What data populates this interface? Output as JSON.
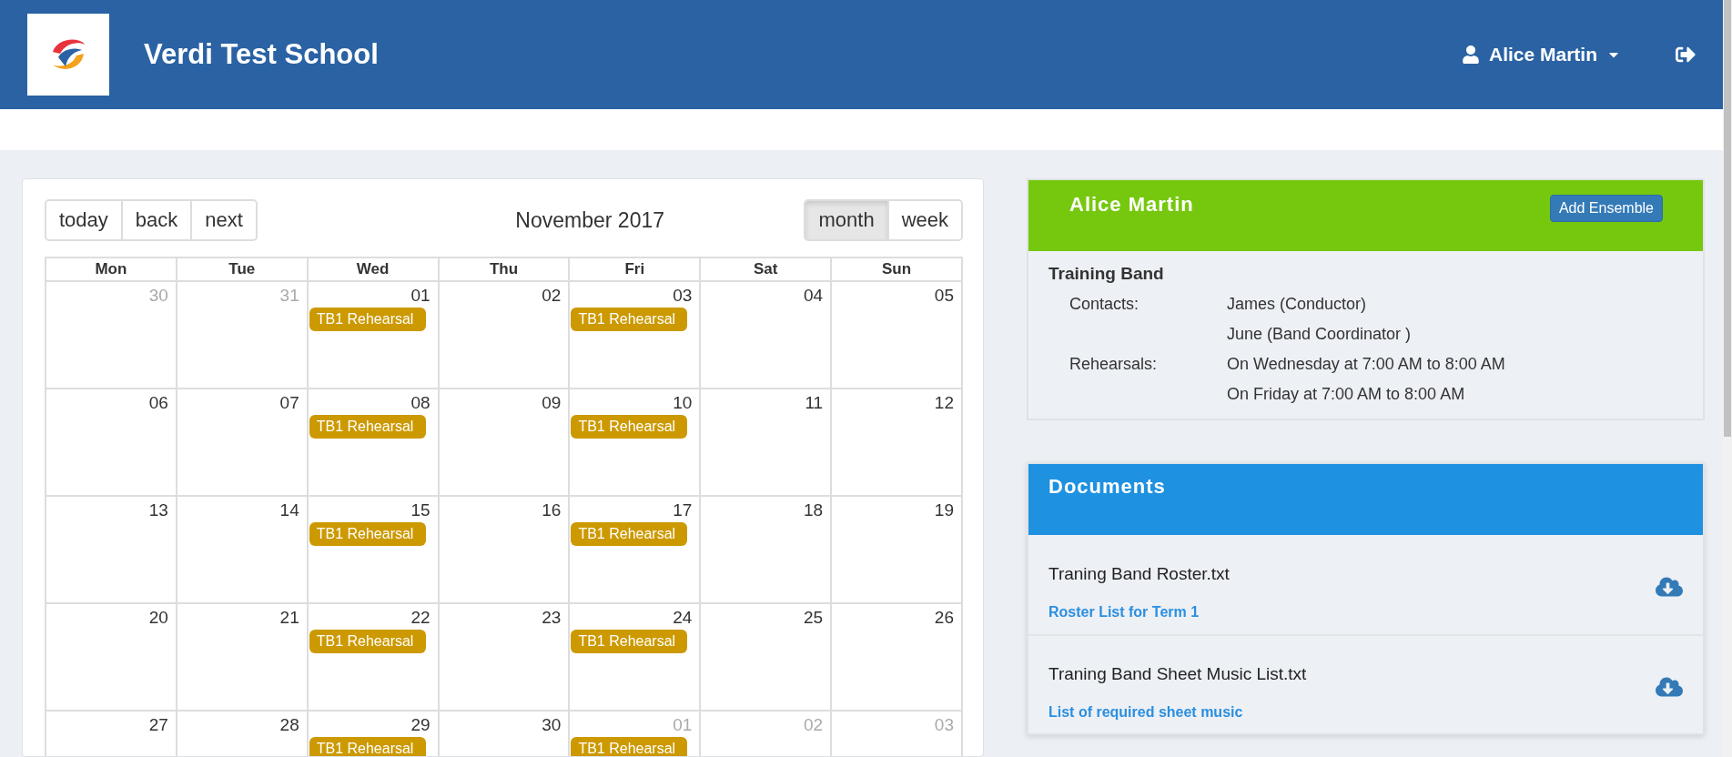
{
  "header": {
    "school": "Verdi Test School",
    "user": "Alice Martin"
  },
  "calendar": {
    "nav_buttons": [
      "today",
      "back",
      "next"
    ],
    "title": "November 2017",
    "views": [
      {
        "label": "month",
        "selected": true
      },
      {
        "label": "week",
        "selected": false
      }
    ],
    "weekdays": [
      "Mon",
      "Tue",
      "Wed",
      "Thu",
      "Fri",
      "Sat",
      "Sun"
    ],
    "weeks": [
      [
        {
          "day": "30",
          "other_month": true
        },
        {
          "day": "31",
          "other_month": true
        },
        {
          "day": "01",
          "other_month": false,
          "events": [
            "TB1 Rehearsal"
          ]
        },
        {
          "day": "02",
          "other_month": false
        },
        {
          "day": "03",
          "other_month": false,
          "events": [
            "TB1 Rehearsal"
          ]
        },
        {
          "day": "04",
          "other_month": false
        },
        {
          "day": "05",
          "other_month": false
        }
      ],
      [
        {
          "day": "06",
          "other_month": false
        },
        {
          "day": "07",
          "other_month": false
        },
        {
          "day": "08",
          "other_month": false,
          "events": [
            "TB1 Rehearsal"
          ]
        },
        {
          "day": "09",
          "other_month": false
        },
        {
          "day": "10",
          "other_month": false,
          "events": [
            "TB1 Rehearsal"
          ]
        },
        {
          "day": "11",
          "other_month": false
        },
        {
          "day": "12",
          "other_month": false
        }
      ],
      [
        {
          "day": "13",
          "other_month": false
        },
        {
          "day": "14",
          "other_month": false
        },
        {
          "day": "15",
          "other_month": false,
          "events": [
            "TB1 Rehearsal"
          ]
        },
        {
          "day": "16",
          "other_month": false
        },
        {
          "day": "17",
          "other_month": false,
          "events": [
            "TB1 Rehearsal"
          ]
        },
        {
          "day": "18",
          "other_month": false
        },
        {
          "day": "19",
          "other_month": false
        }
      ],
      [
        {
          "day": "20",
          "other_month": false
        },
        {
          "day": "21",
          "other_month": false
        },
        {
          "day": "22",
          "other_month": false,
          "events": [
            "TB1 Rehearsal"
          ]
        },
        {
          "day": "23",
          "other_month": false
        },
        {
          "day": "24",
          "other_month": false,
          "events": [
            "TB1 Rehearsal"
          ]
        },
        {
          "day": "25",
          "other_month": false
        },
        {
          "day": "26",
          "other_month": false
        }
      ],
      [
        {
          "day": "27",
          "other_month": false
        },
        {
          "day": "28",
          "other_month": false
        },
        {
          "day": "29",
          "other_month": false,
          "events": [
            "TB1 Rehearsal"
          ]
        },
        {
          "day": "30",
          "other_month": false
        },
        {
          "day": "01",
          "other_month": true,
          "events": [
            "TB1 Rehearsal"
          ]
        },
        {
          "day": "02",
          "other_month": true
        },
        {
          "day": "03",
          "other_month": true
        }
      ]
    ]
  },
  "profile": {
    "name": "Alice Martin",
    "button": "Add Ensemble",
    "ensemble": "Training Band",
    "details": [
      {
        "label": "Contacts:",
        "values": [
          "James (Conductor)",
          "June (Band Coordinator )"
        ]
      },
      {
        "label": "Rehearsals:",
        "values": [
          "On Wednesday at 7:00 AM to 8:00 AM",
          "On Friday at 7:00 AM to 8:00 AM"
        ]
      }
    ]
  },
  "documents": {
    "title": "Documents",
    "items": [
      {
        "name": "Traning Band Roster.txt",
        "description": "Roster List for Term 1"
      },
      {
        "name": "Traning Band Sheet Music List.txt",
        "description": "List of required sheet music"
      }
    ]
  }
}
